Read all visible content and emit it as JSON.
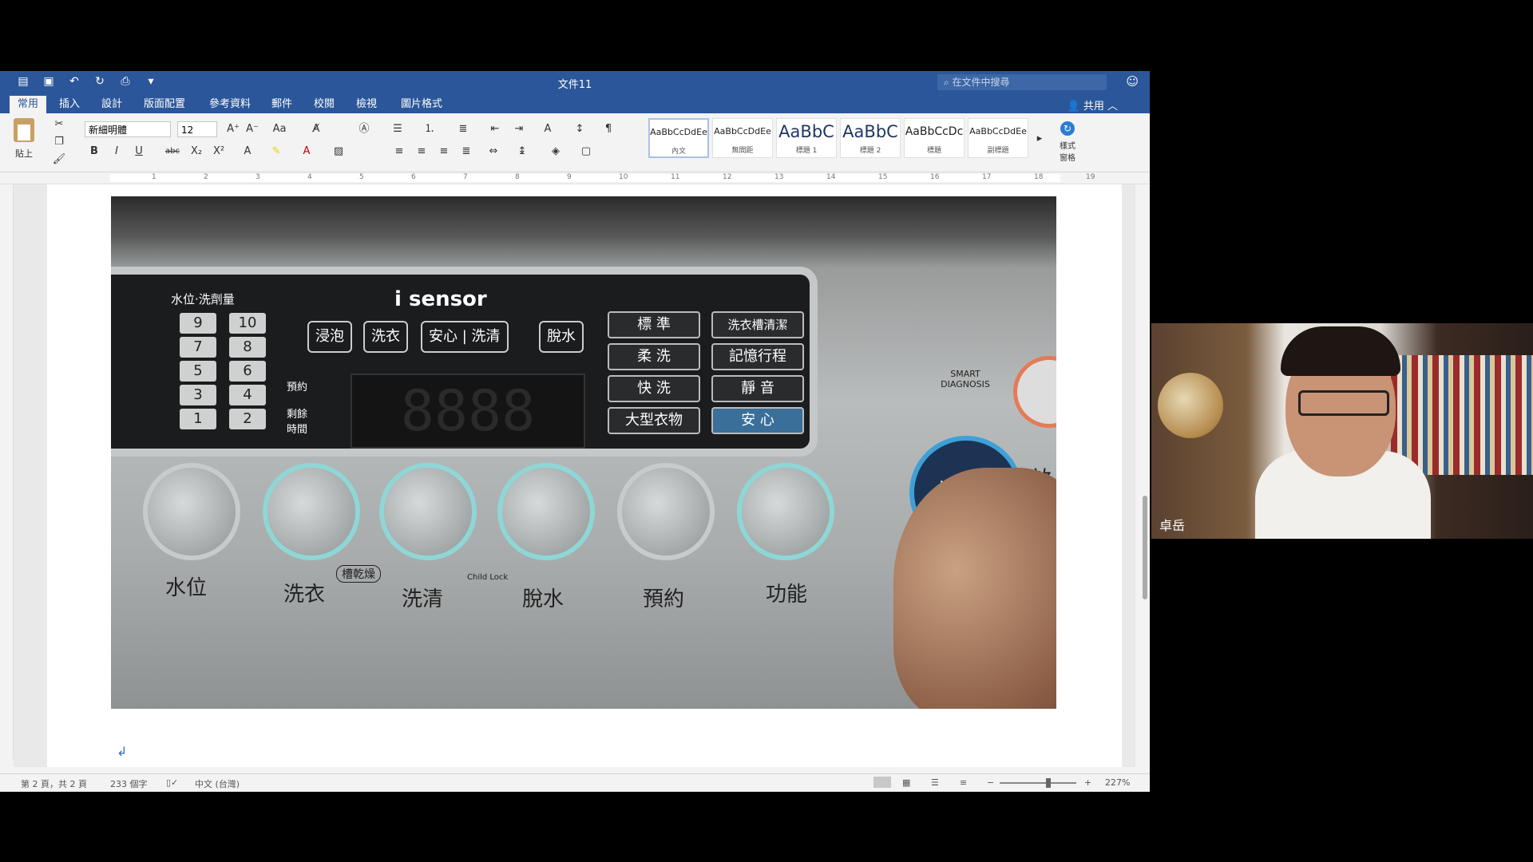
{
  "word": {
    "title": "文件11",
    "search_placeholder": "在文件中搜尋",
    "share_label": "共用",
    "tabs": [
      "常用",
      "插入",
      "設計",
      "版面配置",
      "參考資料",
      "郵件",
      "校閱",
      "檢視",
      "圖片格式"
    ],
    "active_tab": "常用",
    "ribbon": {
      "paste_label": "貼上",
      "font_name": "新細明體",
      "font_size": "12",
      "styles": [
        {
          "preview": "AaBbCcDdEe",
          "name": "內文"
        },
        {
          "preview": "AaBbCcDdEe",
          "name": "無間距"
        },
        {
          "preview": "AaBbC",
          "name": "標題 1"
        },
        {
          "preview": "AaBbC",
          "name": "標題 2"
        },
        {
          "preview": "AaBbCcDc",
          "name": "標題"
        },
        {
          "preview": "AaBbCcDdEe",
          "name": "副標題"
        }
      ],
      "styles_pane_label": "樣式\n窗格"
    },
    "ruler_numbers": [
      "1",
      "2",
      "3",
      "4",
      "5",
      "6",
      "7",
      "8",
      "9",
      "10",
      "11",
      "12",
      "13",
      "14",
      "15",
      "16",
      "17",
      "18",
      "19"
    ],
    "status": {
      "page": "第 2 頁，共 2 頁",
      "words": "233 個字",
      "language": "中文 (台灣)",
      "zoom": "227%"
    }
  },
  "photo": {
    "brand_text": "i sensor",
    "panel_header": "水位·洗劑量",
    "sequence": [
      "浸泡",
      "洗衣",
      "安心 | 洗清",
      "脫水"
    ],
    "numbers": [
      "9",
      "10",
      "7",
      "8",
      "5",
      "6",
      "3",
      "4",
      "1",
      "2"
    ],
    "timer_labels": [
      "預約",
      "剩餘\n時間"
    ],
    "programs": [
      "標 準",
      "洗衣槽清潔",
      "柔 洗",
      "記憶行程",
      "快 洗",
      "靜 音",
      "大型衣物",
      "安 心"
    ],
    "buttons": [
      "水位",
      "洗衣",
      "洗清",
      "脫水",
      "預約",
      "功能"
    ],
    "dry_label": "槽乾燥",
    "child_lock": "Child Lock",
    "smart_diag": "SMART\nDIAGNOSIS",
    "start_label": "啟\n暫"
  },
  "video": {
    "participant_name": "卓岳"
  }
}
